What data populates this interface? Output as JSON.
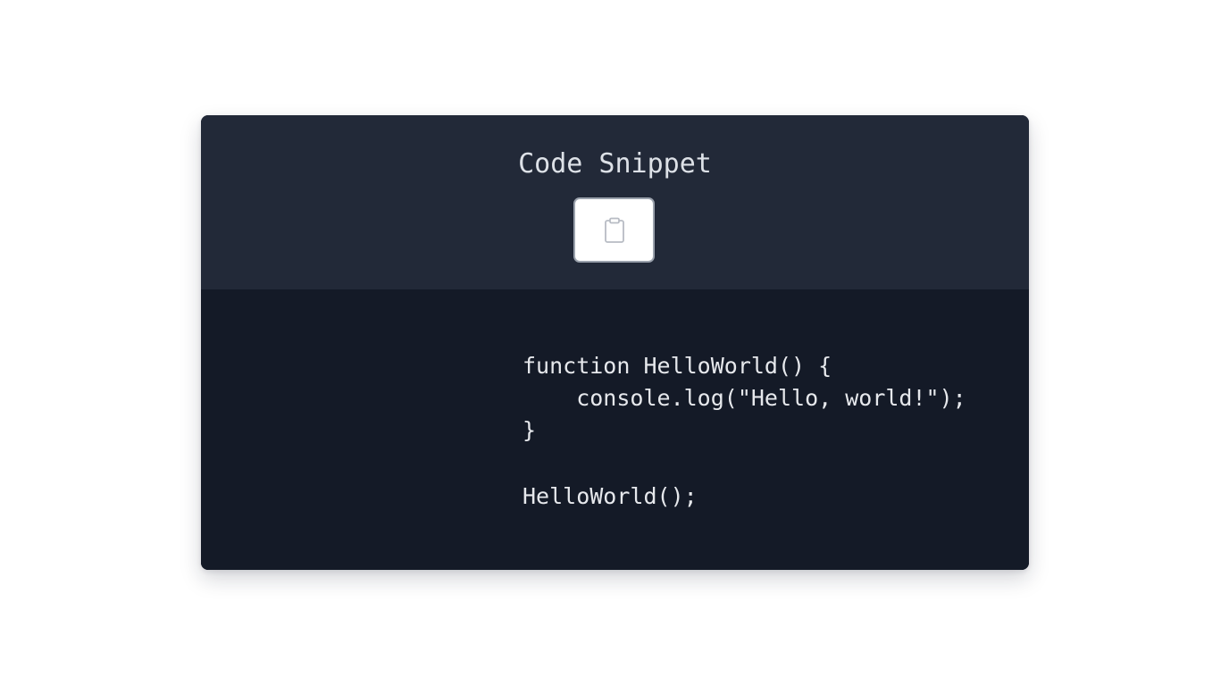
{
  "card": {
    "title": "Code Snippet",
    "copy_button": {
      "icon": "clipboard-icon"
    },
    "code": {
      "lines": [
        "function HelloWorld() {",
        "    console.log(\"Hello, world!\");",
        "}",
        "",
        "HelloWorld();"
      ]
    }
  },
  "colors": {
    "page_background": "#ffffff",
    "header_background": "#222938",
    "code_background": "#141a27",
    "title_text": "#dde1e7",
    "code_text": "#e6e8ec",
    "button_background": "#ffffff",
    "button_border": "#9aa1ac",
    "icon_stroke": "#b8bcc4"
  }
}
